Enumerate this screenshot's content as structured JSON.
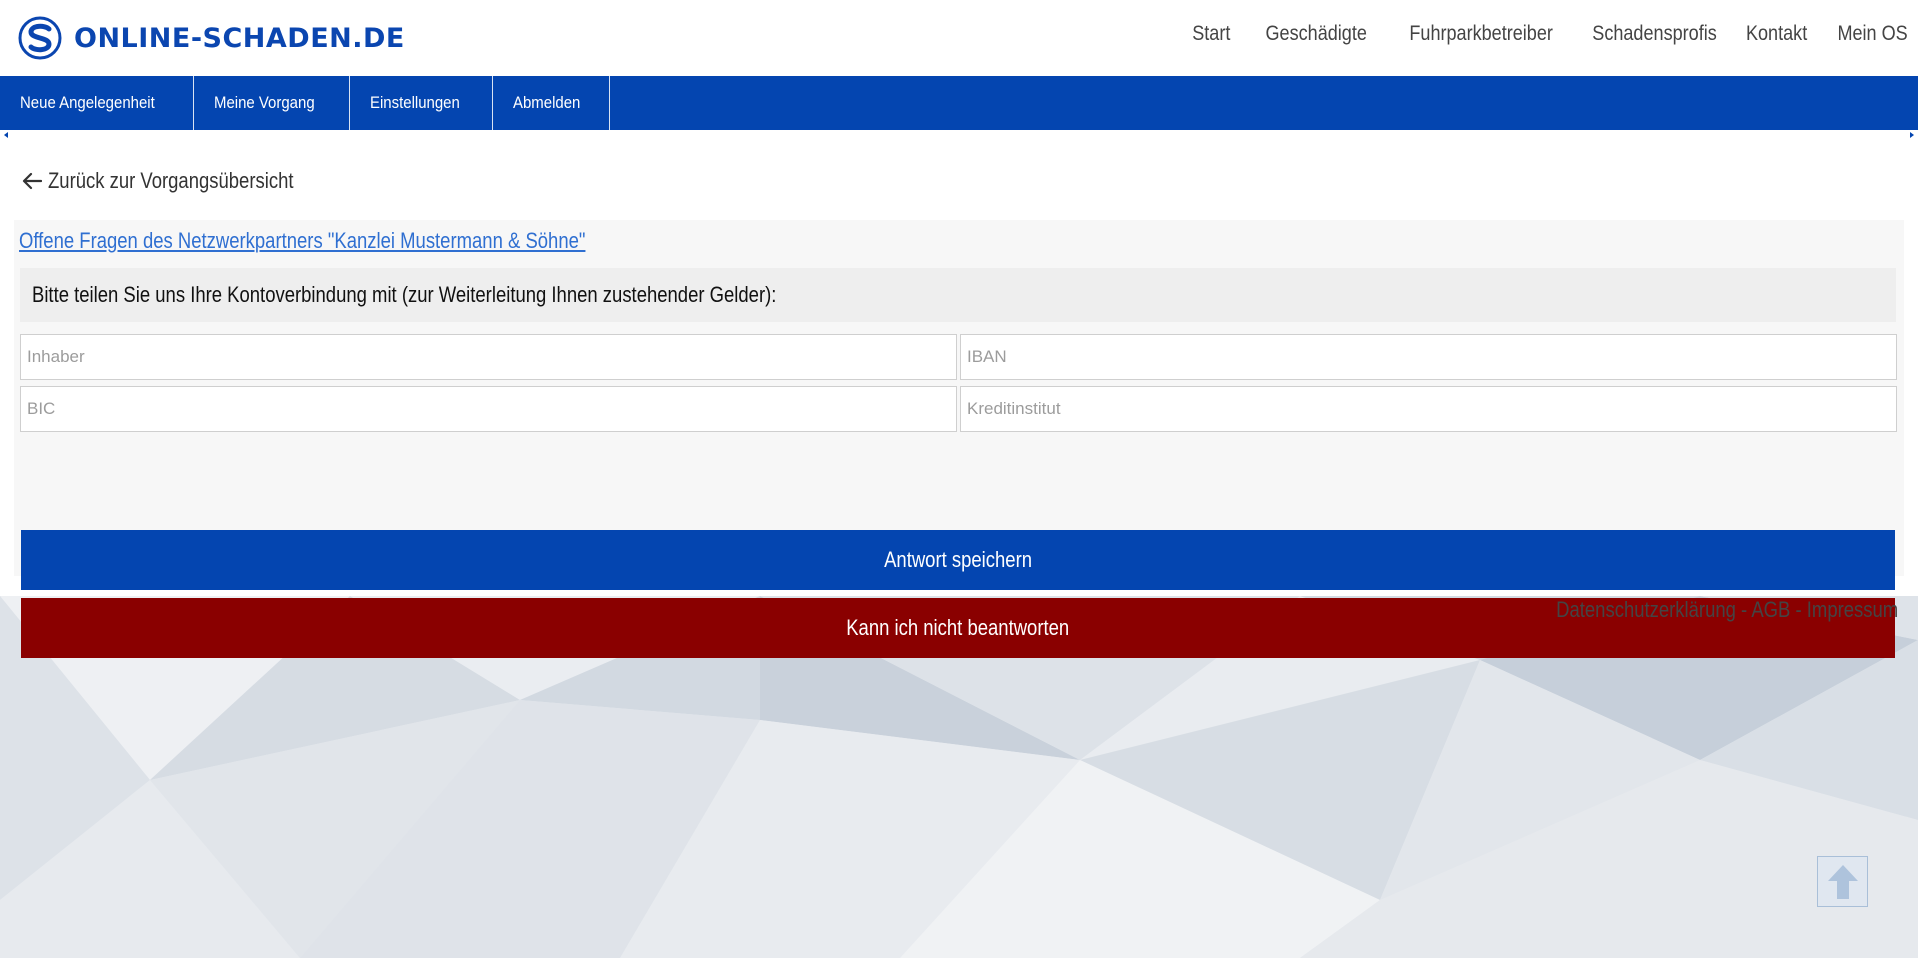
{
  "brand": {
    "name": "ONLINE-SCHADEN.DE",
    "logo_icon": "swirl-s-logo-icon",
    "color": "#0b46b0"
  },
  "top_nav": [
    "Start",
    "Geschädigte",
    "Fuhrparkbetreiber",
    "Schadensprofis",
    "Kontakt",
    "Mein OS"
  ],
  "sub_nav": [
    "Neue Angelegenheit",
    "Meine Vorgang",
    "Einstellungen",
    "Abmelden"
  ],
  "back_link": {
    "label": "Zurück zur Vorgangsübersicht",
    "icon": "arrow-left-icon"
  },
  "panel": {
    "title": "Offene Fragen des Netzwerkpartners \"Kanzlei Mustermann & Söhne\"",
    "question": "Bitte teilen Sie uns Ihre Kontoverbindung mit (zur Weiterleitung Ihnen zustehender Gelder):",
    "fields": {
      "inhaber": {
        "placeholder": "Inhaber",
        "value": ""
      },
      "iban": {
        "placeholder": "IBAN",
        "value": ""
      },
      "bic": {
        "placeholder": "BIC",
        "value": ""
      },
      "kreditinstitut": {
        "placeholder": "Kreditinstitut",
        "value": ""
      }
    },
    "save_label": "Antwort speichern",
    "cannot_label": "Kann ich nicht beantworten"
  },
  "footer": {
    "links": [
      "Datenschutzerklärung",
      "AGB",
      "Impressum"
    ],
    "separator": " - "
  },
  "scroll_top_icon": "arrow-up-icon",
  "colors": {
    "primary_blue": "#0445b0",
    "danger_red": "#8a0000",
    "link_blue": "#2f6fd1"
  }
}
